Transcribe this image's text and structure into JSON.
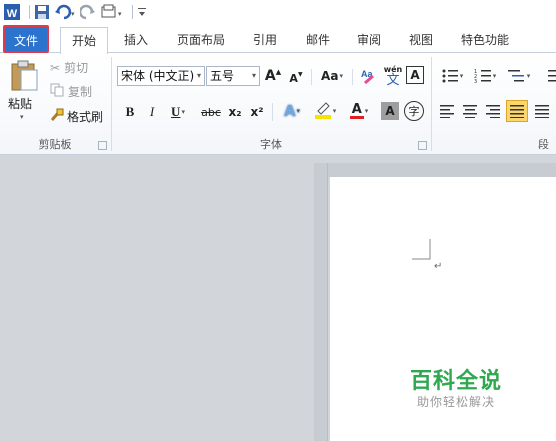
{
  "tabs": {
    "file": "文件",
    "home": "开始",
    "insert": "插入",
    "page_layout": "页面布局",
    "references": "引用",
    "mailings": "邮件",
    "review": "审阅",
    "view": "视图",
    "features": "特色功能"
  },
  "clipboard": {
    "paste": "粘贴",
    "cut": "剪切",
    "copy": "复制",
    "format_painter": "格式刷",
    "label": "剪贴板"
  },
  "font": {
    "font_name": "宋体 (中文正)",
    "font_size": "五号",
    "grow": "A",
    "shrink": "A",
    "change_case": "Aa",
    "bold": "B",
    "italic": "I",
    "underline": "U",
    "strike": "abc",
    "subscript": "x₂",
    "superscript": "x²",
    "text_effect": "A",
    "font_color": "A",
    "char_shading": "A",
    "enclose": "字",
    "phonetic": "wén",
    "phonetic_char": "文",
    "label": "字体"
  },
  "paragraph": {
    "label": "段"
  },
  "watermark": {
    "title": "百科全说",
    "subtitle": "助你轻松解决"
  },
  "colors": {
    "file_tab": "#2b73cc",
    "highlight_box": "#e0394b",
    "watermark": "#2fa84f",
    "font_color_bar": "#e02020",
    "highlight_bar": "#f5e400"
  }
}
